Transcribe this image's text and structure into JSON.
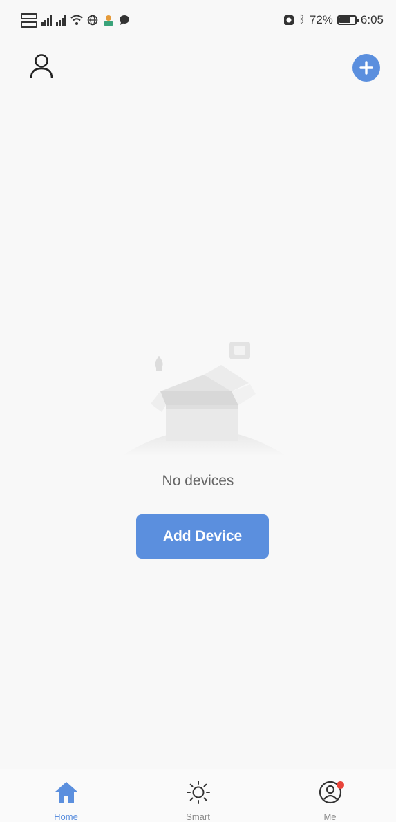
{
  "status_bar": {
    "battery_level": "72%",
    "time": "6:05",
    "battery_fraction": 0.72
  },
  "header": {
    "user_icon": "user-icon",
    "add_icon": "plus-circle-icon"
  },
  "empty_state": {
    "message": "No devices",
    "button_label": "Add Device"
  },
  "bottom_nav": {
    "items": [
      {
        "label": "Home",
        "icon": "home-icon",
        "active": true
      },
      {
        "label": "Smart",
        "icon": "sun-icon",
        "active": false
      },
      {
        "label": "Me",
        "icon": "profile-icon",
        "active": false
      }
    ]
  },
  "colors": {
    "accent": "#5b8fde",
    "background": "#f8f8f8",
    "notification": "#e8443a"
  }
}
